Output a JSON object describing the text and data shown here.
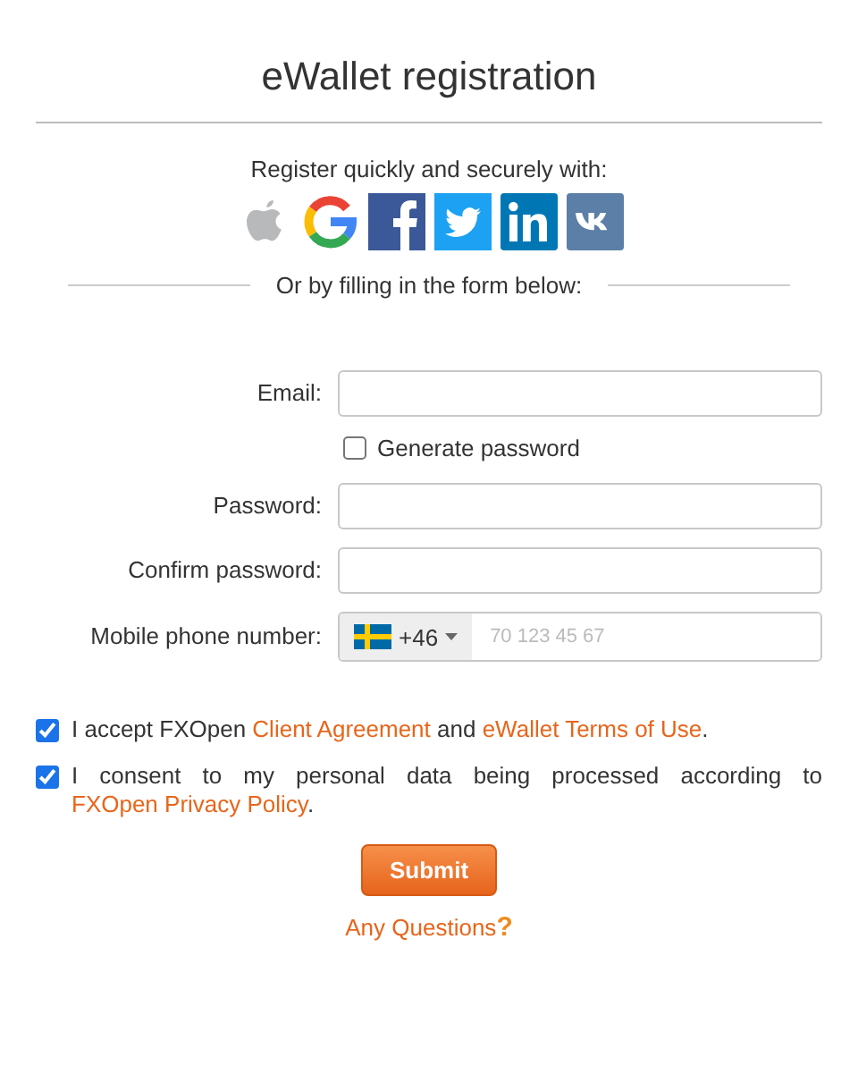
{
  "title": "eWallet registration",
  "social": {
    "heading": "Register quickly and securely with:",
    "providers": [
      {
        "kind": "apple"
      },
      {
        "kind": "google"
      },
      {
        "kind": "facebook"
      },
      {
        "kind": "twitter"
      },
      {
        "kind": "linkedin"
      },
      {
        "kind": "vk"
      }
    ]
  },
  "divider_text": "Or by filling in the form below:",
  "email": {
    "label": "Email:"
  },
  "generate_password": {
    "label": "Generate password",
    "checked": false
  },
  "password": {
    "label": "Password:"
  },
  "confirm_password": {
    "label": "Confirm password:"
  },
  "phone": {
    "label": "Mobile phone number:",
    "country_code": "+46",
    "placeholder": "70 123 45 67"
  },
  "consents": [
    {
      "checked": true,
      "parts": [
        {
          "kind": "text",
          "text": "I accept FXOpen "
        },
        {
          "kind": "link",
          "text": "Client Agreement"
        },
        {
          "kind": "text",
          "text": " and "
        },
        {
          "kind": "link",
          "text": "eWallet Terms of Use"
        },
        {
          "kind": "text",
          "text": "."
        }
      ]
    },
    {
      "checked": true,
      "parts": [
        {
          "kind": "text",
          "text": "I consent to my personal data being processed according to "
        },
        {
          "kind": "link",
          "text": "FXOpen Privacy Policy"
        },
        {
          "kind": "text",
          "text": "."
        }
      ]
    }
  ],
  "submit": "Submit",
  "questions": {
    "label": "Any Questions",
    "mark": "?"
  }
}
